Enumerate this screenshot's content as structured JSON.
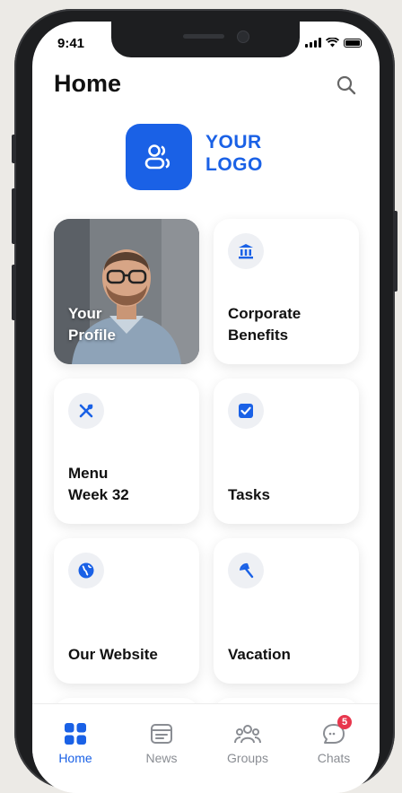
{
  "status_bar": {
    "time": "9:41"
  },
  "header": {
    "title": "Home"
  },
  "logo": {
    "line1": "YOUR",
    "line2": "LOGO"
  },
  "tiles": {
    "profile": {
      "line1": "Your",
      "line2": "Profile"
    },
    "benefits": {
      "line1": "Corporate",
      "line2": "Benefits"
    },
    "menu": {
      "line1": "Menu",
      "line2": "Week 32"
    },
    "tasks": {
      "label": "Tasks"
    },
    "website": {
      "label": "Our Website"
    },
    "vacation": {
      "label": "Vacation"
    }
  },
  "tabbar": {
    "home": "Home",
    "news": "News",
    "groups": "Groups",
    "chats": "Chats",
    "chats_badge": "5"
  },
  "colors": {
    "accent": "#1a61e6",
    "badge": "#e8364d",
    "decor": "#3ccf86"
  }
}
